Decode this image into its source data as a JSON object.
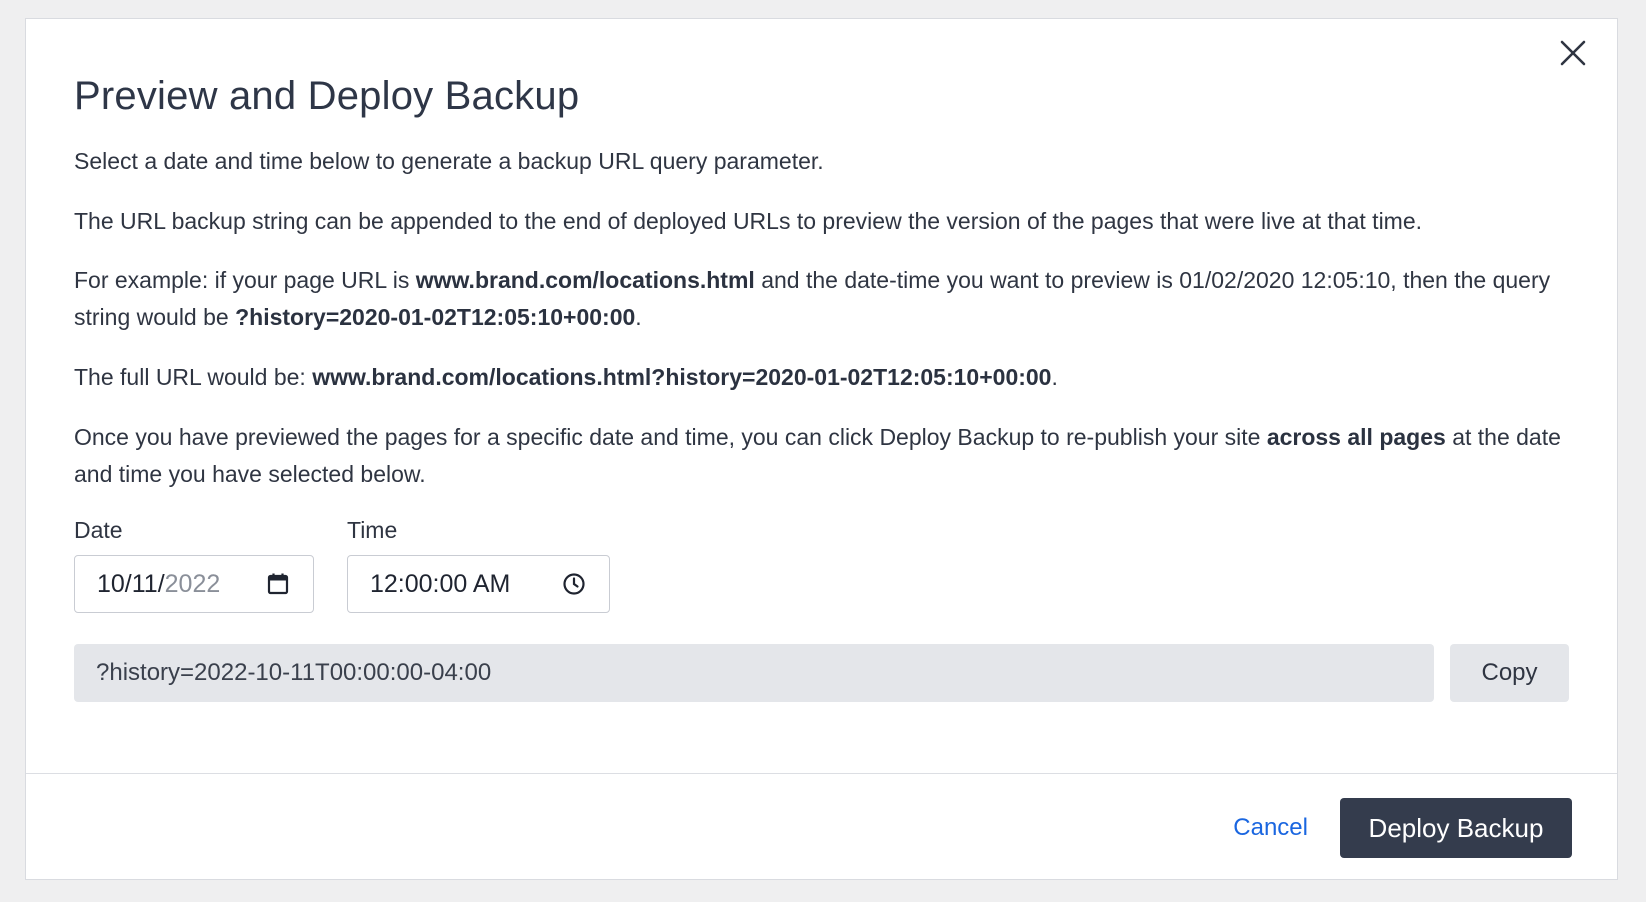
{
  "dialog": {
    "title": "Preview and Deploy Backup",
    "close_icon": "close-icon"
  },
  "intro": {
    "p1": "Select a date and time below to generate a backup URL query parameter.",
    "p2": "The URL backup string can be appended to the end of deployed URLs to preview the version of the pages that were live at that time.",
    "p3_a": "For example: if your page URL is ",
    "p3_url": "www.brand.com/locations.html",
    "p3_b": " and the date-time you want to preview is 01/02/2020 12:05:10, then the query string would be ",
    "p3_query": "?history=2020-01-02T12:05:10+00:00",
    "p3_c": ".",
    "p4_a": "The full URL would be: ",
    "p4_url": "www.brand.com/locations.html?history=2020-01-02T12:05:10+00:00",
    "p4_b": ".",
    "p5_a": "Once you have previewed the pages for a specific date and time, you can click Deploy Backup to re-publish your site ",
    "p5_bold": "across all pages",
    "p5_b": " at the date and time you have selected below."
  },
  "date_field": {
    "label": "Date",
    "value_main": "10/11/",
    "value_muted": "2022",
    "icon": "calendar-icon"
  },
  "time_field": {
    "label": "Time",
    "value": "12:00:00 AM",
    "icon": "clock-icon"
  },
  "query": {
    "value": "?history=2022-10-11T00:00:00-04:00",
    "copy_label": "Copy"
  },
  "footer": {
    "cancel_label": "Cancel",
    "deploy_label": "Deploy Backup"
  },
  "colors": {
    "primary_button": "#343c4d",
    "link": "#1a66e0",
    "readonly_field": "#e4e6ea"
  }
}
